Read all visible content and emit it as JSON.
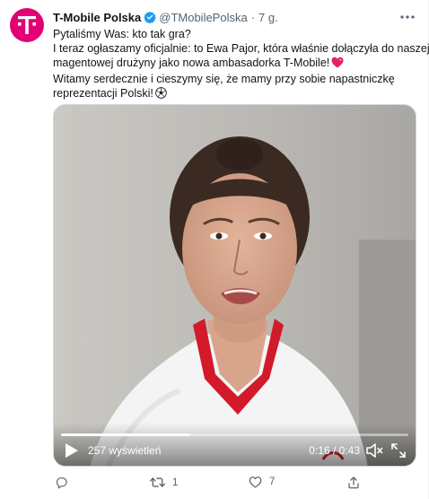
{
  "tweet": {
    "author_name": "T-Mobile Polska",
    "handle": "@TMobilePolska",
    "separator": "·",
    "time": "7 g.",
    "avatar_icon": "tmobile-logo",
    "brand_color": "#e20074",
    "verified_color": "#1d9bf0",
    "text_lines": [
      "Pytaliśmy Was: kto tak gra?",
      "I teraz ogłaszamy oficjalnie: to Ewa Pajor, która właśnie dołączyła do naszej",
      "magentowej drużyny jako nowa ambasadorka T-Mobile!",
      "Witamy serdecznie i cieszymy się, że mamy przy sobie napastniczkę",
      "reprezentacji Polski!"
    ],
    "emojis": [
      "heart-emoji",
      "soccer-ball-emoji"
    ]
  },
  "video": {
    "views": "257 wyświetleń",
    "timecode": "0:16 / 0:43",
    "progress_fraction": 0.37
  },
  "actions": {
    "reply_count": "",
    "retweet_count": "1",
    "like_count": "7",
    "share_count": ""
  }
}
